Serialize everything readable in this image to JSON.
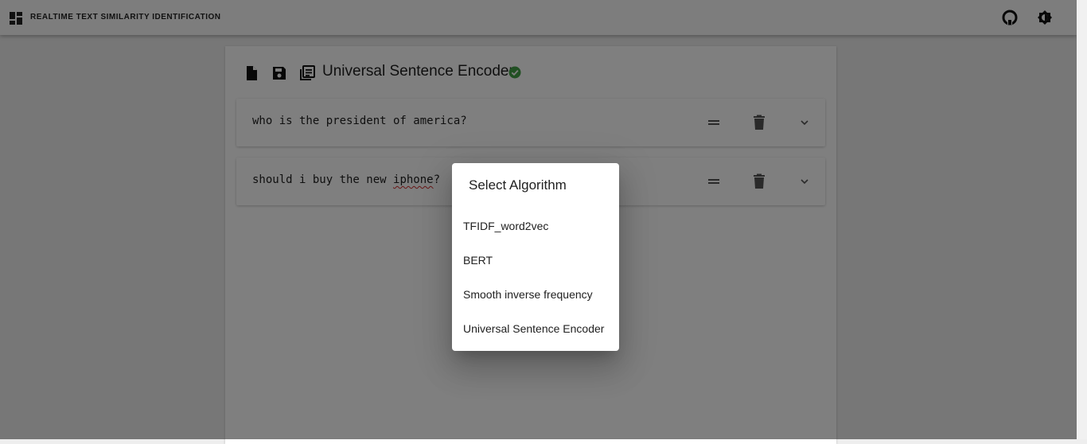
{
  "app": {
    "title": "REALTIME TEXT SIMILARITY IDENTIFICATION",
    "icons": {
      "logo": "dashboard-icon",
      "github": "github-icon",
      "theme": "brightness-icon"
    }
  },
  "toolbar": {
    "icons": [
      "new-file-icon",
      "save-icon",
      "library-icon"
    ],
    "model_name": "Universal Sentence Encoder",
    "status_icon": "check-circle-icon",
    "status_color": "#43a047"
  },
  "sentences": [
    {
      "before": "who is the president of america?",
      "misspelled": "",
      "after": ""
    },
    {
      "before": "should i buy the new ",
      "misspelled": "iphone",
      "after": "?"
    }
  ],
  "card_icons": [
    "drag-handle-icon",
    "delete-icon",
    "expand-icon"
  ],
  "dialog": {
    "title": "Select Algorithm",
    "options": [
      "TFIDF_word2vec",
      "BERT",
      "Smooth inverse frequency",
      "Universal Sentence Encoder"
    ]
  }
}
